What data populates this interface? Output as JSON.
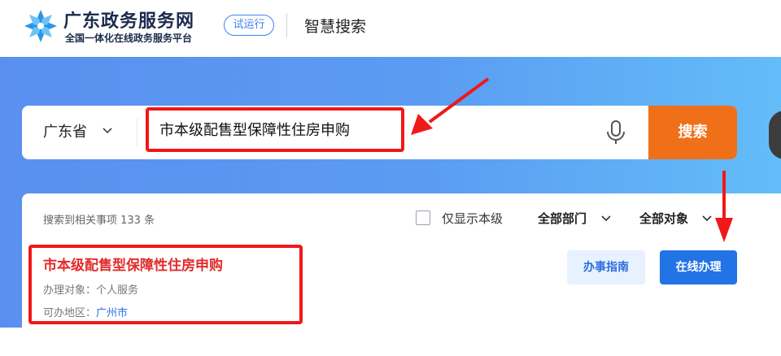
{
  "header": {
    "brand_title": "广东政务服务网",
    "brand_subtitle": "全国一体化在线政务服务平台",
    "trial_badge": "试运行",
    "page_heading": "智慧搜索"
  },
  "search": {
    "region": "广东省",
    "query": "市本级配售型保障性住房申购",
    "button_label": "搜索"
  },
  "results": {
    "count_text": "搜索到相关事项 133 条",
    "filter_only_level": "仅显示本级",
    "filter_department": "全部部门",
    "filter_target": "全部对象",
    "items": [
      {
        "title": "市本级配售型保障性住房申购",
        "target_label": "办理对象：",
        "target_value": "个人服务",
        "area_label": "可办地区：",
        "area_value": "广州市",
        "guide_button": "办事指南",
        "online_button": "在线办理"
      }
    ]
  },
  "colors": {
    "accent_orange": "#f07019",
    "primary_blue": "#2273e6",
    "annotation_red": "#f01818"
  },
  "icons": [
    "logo-icon",
    "chevron-down-icon",
    "microphone-icon",
    "checkbox-icon"
  ]
}
